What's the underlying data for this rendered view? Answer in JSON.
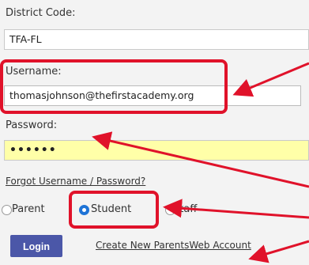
{
  "form": {
    "district_label": "District Code:",
    "district_value": "TFA-FL",
    "username_label": "Username:",
    "username_value": "thomasjohnson@thefirstacademy.org",
    "password_label": "Password:",
    "password_value": "••••••",
    "forgot_link": "Forgot Username / Password?",
    "roles": [
      "Parent",
      "Student",
      "Staff"
    ],
    "selected_role": "Student",
    "login_label": "Login",
    "create_account_link": "Create New ParentsWeb Account"
  },
  "colors": {
    "highlight": "#e0122a",
    "login_button": "#4b57a8",
    "password_bg": "#ffffa8",
    "radio_selected": "#1e73d6"
  }
}
